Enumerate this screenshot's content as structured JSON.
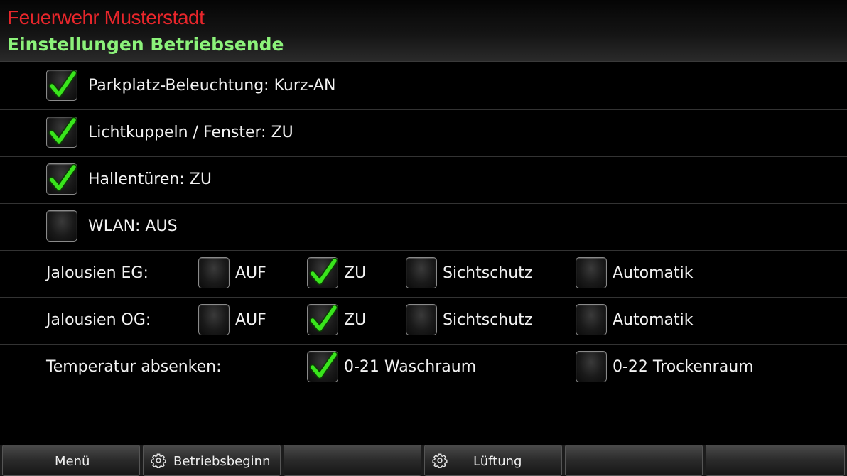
{
  "header": {
    "org": "Feuerwehr Musterstadt",
    "title": "Einstellungen Betriebsende"
  },
  "rows": [
    {
      "label": "Parkplatz-Beleuchtung: Kurz-AN",
      "checked": true
    },
    {
      "label": "Lichtkuppeln / Fenster: ZU",
      "checked": true
    },
    {
      "label": "Hallentüren: ZU",
      "checked": true
    },
    {
      "label": "WLAN: AUS",
      "checked": false
    }
  ],
  "jalousien_eg": {
    "label": "Jalousien EG:",
    "options": [
      {
        "label": "AUF",
        "checked": false
      },
      {
        "label": "ZU",
        "checked": true
      },
      {
        "label": "Sichtschutz",
        "checked": false
      },
      {
        "label": "Automatik",
        "checked": false
      }
    ]
  },
  "jalousien_og": {
    "label": "Jalousien OG:",
    "options": [
      {
        "label": "AUF",
        "checked": false
      },
      {
        "label": "ZU",
        "checked": true
      },
      {
        "label": "Sichtschutz",
        "checked": false
      },
      {
        "label": "Automatik",
        "checked": false
      }
    ]
  },
  "temperatur": {
    "label": "Temperatur absenken:",
    "options": [
      {
        "label": "0-21 Waschraum",
        "checked": true
      },
      {
        "label": "0-22 Trockenraum",
        "checked": false
      }
    ]
  },
  "footer": {
    "buttons": [
      {
        "label": "Menü",
        "icon": ""
      },
      {
        "label": "Betriebsbeginn",
        "icon": "gear-icon"
      },
      {
        "label": "",
        "icon": ""
      },
      {
        "label": "Lüftung",
        "icon": "gear-icon"
      },
      {
        "label": "",
        "icon": ""
      },
      {
        "label": "",
        "icon": ""
      }
    ]
  },
  "colors": {
    "org": "#e8262b",
    "title": "#8cf27a",
    "check": "#39e51c"
  }
}
